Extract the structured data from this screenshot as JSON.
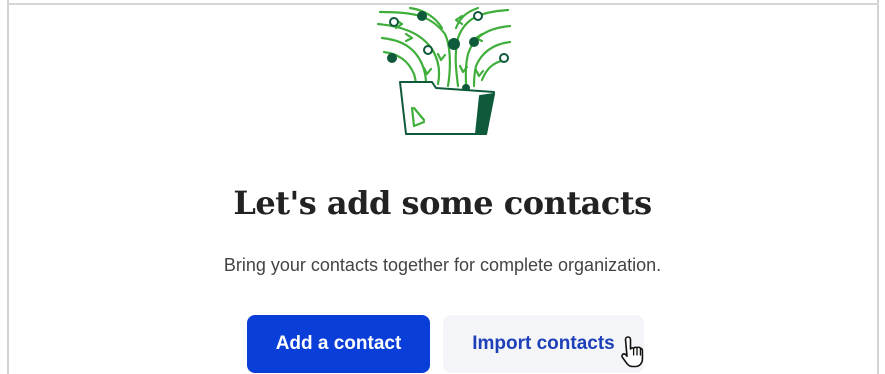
{
  "empty_state": {
    "illustration_icon": "contacts-folder-illustration",
    "title": "Let's add some contacts",
    "subtitle": "Bring your contacts together for complete organization."
  },
  "actions": {
    "add_contact_label": "Add a contact",
    "import_contacts_label": "Import contacts"
  },
  "colors": {
    "primary_button": "#0a3ed9",
    "secondary_button_bg": "#f3f5f8",
    "secondary_button_text": "#1d3fb8",
    "illustration_green_light": "#3fae3b",
    "illustration_green_dark": "#0e5a3a"
  },
  "cursor_icon": "hand-pointer-icon"
}
